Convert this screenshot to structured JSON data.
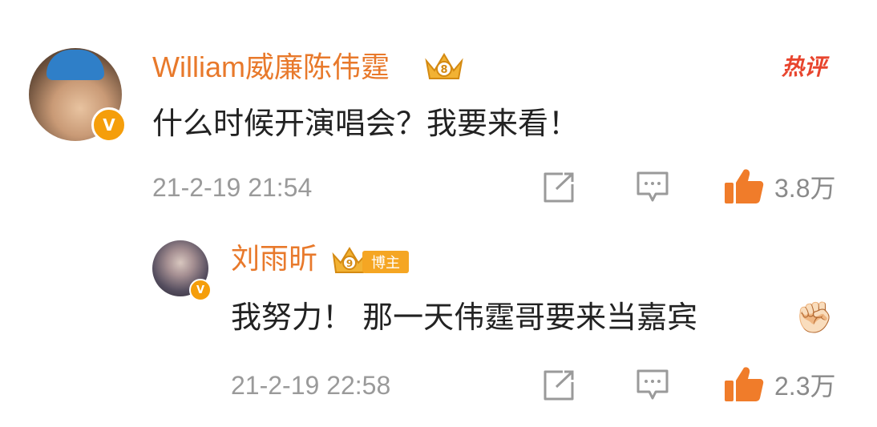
{
  "comment": {
    "user_name": "William威廉陈伟霆",
    "text": "什么时候开演唱会？我要来看！",
    "timestamp": "21-2-19 21:54",
    "like_count": "3.8万",
    "hot_label": "热评",
    "verified_badge": "V",
    "vip_badge_level": "8"
  },
  "reply": {
    "user_name": "刘雨昕",
    "role_tag": "博主",
    "text": "我努力！ 那一天伟霆哥要来当嘉宾",
    "emoji": "✊🏻",
    "timestamp": "21-2-19 22:58",
    "like_count": "2.3万",
    "verified_badge": "V",
    "vip_badge_level": "9"
  },
  "icons": {
    "share": "share-icon",
    "comment": "comment-icon",
    "like": "thumbs-up-icon"
  },
  "colors": {
    "username": "#e8792b",
    "like_icon": "#f07c2a",
    "hot_label": "#e8452e",
    "verified": "#f59e0b"
  }
}
